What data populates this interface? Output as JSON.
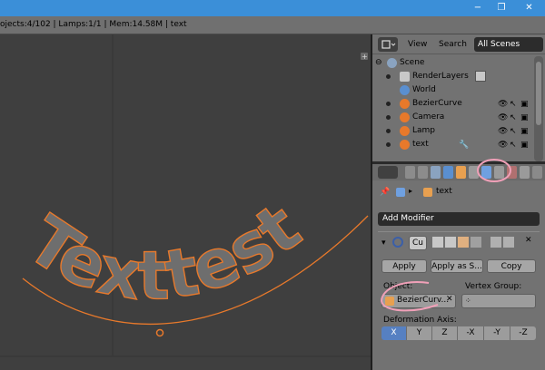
{
  "infobar": {
    "text": "ojects:4/102 | Lamps:1/1 | Mem:14.58M | text"
  },
  "window_controls": {
    "minimize": "−",
    "restore": "❐",
    "close": "✕"
  },
  "outliner": {
    "view_label": "View",
    "search_label": "Search",
    "display_mode": "All Scenes",
    "items": [
      {
        "label": "Scene"
      },
      {
        "label": "RenderLayers"
      },
      {
        "label": "World"
      },
      {
        "label": "BezierCurve"
      },
      {
        "label": "Camera"
      },
      {
        "label": "Lamp"
      },
      {
        "label": "text"
      }
    ]
  },
  "properties": {
    "context_object": "text",
    "add_modifier_label": "Add Modifier",
    "modifier": {
      "name": "Cu",
      "apply_label": "Apply",
      "apply_as_label": "Apply as S...",
      "copy_label": "Copy",
      "object_label": "Object:",
      "object_value": "BezierCurv...",
      "vertex_group_label": "Vertex Group:",
      "deform_axis_label": "Deformation Axis:",
      "axes": [
        "X",
        "Y",
        "Z",
        "-X",
        "-Y",
        "-Z"
      ],
      "active_axis": "X"
    }
  },
  "viewport": {
    "curve_text": "Texttest"
  },
  "colors": {
    "titlebar": "#3b8fd8",
    "viewport_bg": "#3f3f3f",
    "panel_bg": "#727272",
    "curve_orange": "#e8792b",
    "text_grey": "#6e6e6e",
    "active_axis": "#5680c2",
    "annotation_pink": "#f0a0b8"
  },
  "icons": [
    "wrench-icon",
    "eye-icon",
    "cursor-icon",
    "camera-render-icon",
    "pin-icon",
    "cube-icon"
  ]
}
